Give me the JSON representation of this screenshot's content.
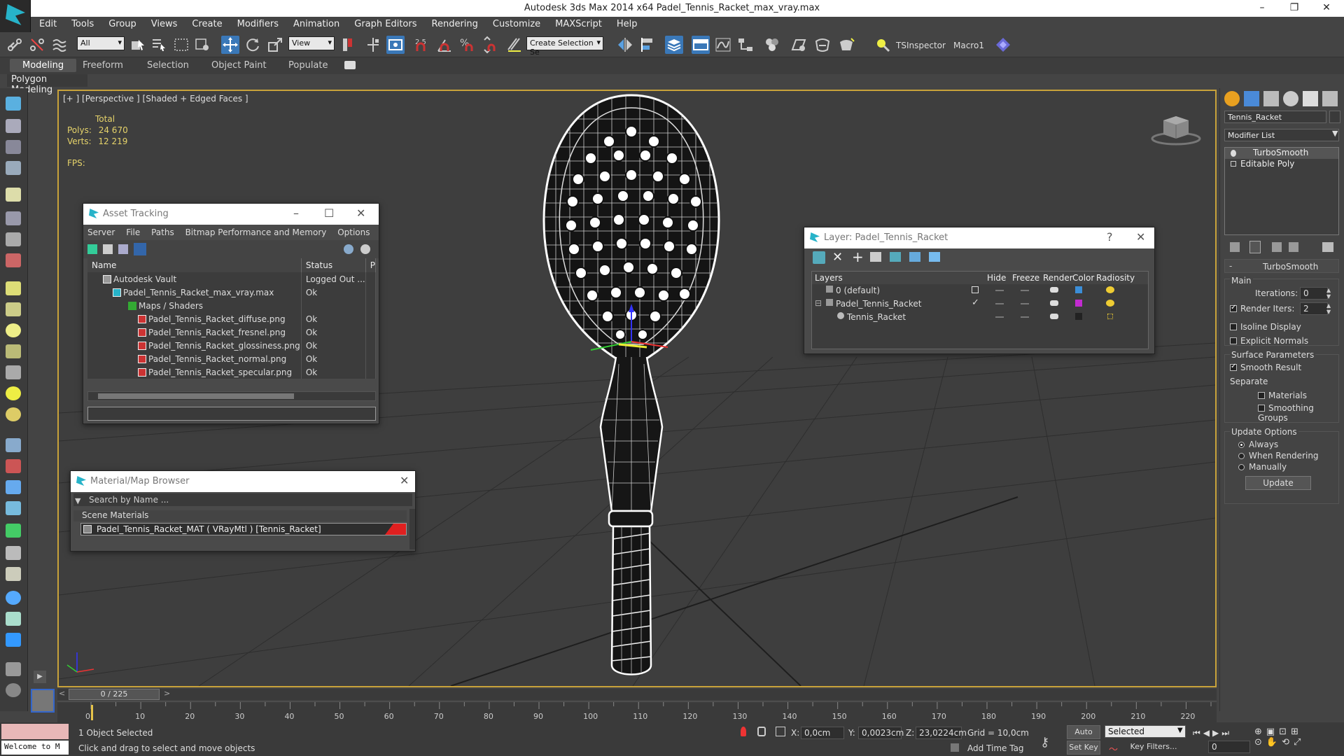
{
  "window": {
    "title": "Autodesk 3ds Max  2014 x64     Padel_Tennis_Racket_max_vray.max"
  },
  "menu": [
    "Edit",
    "Tools",
    "Group",
    "Views",
    "Create",
    "Modifiers",
    "Animation",
    "Graph Editors",
    "Rendering",
    "Customize",
    "MAXScript",
    "Help"
  ],
  "toolbar": {
    "selection_filter": "All",
    "ref_coord": "View",
    "snap_angle": "2.5",
    "named_selection": "Create Selection Se",
    "ts_inspector": "TSInspector",
    "macro": "Macro1"
  },
  "ribbon": {
    "tabs": [
      "Modeling",
      "Freeform",
      "Selection",
      "Object Paint",
      "Populate"
    ],
    "sub_label": "Polygon Modeling"
  },
  "viewport": {
    "label": "[+ ] [Perspective ] [Shaded + Edged Faces ]",
    "stats_header": "Total",
    "polys_label": "Polys:",
    "polys_value": "24 670",
    "verts_label": "Verts:",
    "verts_value": "12 219",
    "fps_label": "FPS:"
  },
  "asset_tracking": {
    "title": "Asset Tracking",
    "menu": [
      "Server",
      "File",
      "Paths",
      "Bitmap Performance and Memory",
      "Options"
    ],
    "columns": [
      "Name",
      "Status",
      "P"
    ],
    "rows": [
      {
        "name": "Autodesk Vault",
        "status": "Logged Out ..."
      },
      {
        "name": "Padel_Tennis_Racket_max_vray.max",
        "status": "Ok"
      },
      {
        "name": "Maps / Shaders",
        "status": ""
      },
      {
        "name": "Padel_Tennis_Racket_diffuse.png",
        "status": "Ok"
      },
      {
        "name": "Padel_Tennis_Racket_fresnel.png",
        "status": "Ok"
      },
      {
        "name": "Padel_Tennis_Racket_glossiness.png",
        "status": "Ok"
      },
      {
        "name": "Padel_Tennis_Racket_normal.png",
        "status": "Ok"
      },
      {
        "name": "Padel_Tennis_Racket_specular.png",
        "status": "Ok"
      }
    ]
  },
  "layer_window": {
    "title": "Layer: Padel_Tennis_Racket",
    "help": "?",
    "columns": [
      "Layers",
      "Hide",
      "Freeze",
      "Render",
      "Color",
      "Radiosity"
    ],
    "rows": [
      {
        "name": "0 (default)",
        "color": "#3b8ed8"
      },
      {
        "name": "Padel_Tennis_Racket",
        "color": "#c22bd0"
      },
      {
        "name": "Tennis_Racket",
        "color": "#222222"
      }
    ]
  },
  "material_browser": {
    "title": "Material/Map Browser",
    "search_placeholder": "Search by Name ...",
    "category": "Scene Materials",
    "material": "Padel_Tennis_Racket_MAT  ( VRayMtl )  [Tennis_Racket]"
  },
  "command_panel": {
    "object_name": "Tennis_Racket",
    "modifier_list": "Modifier List",
    "stack": [
      "TurboSmooth",
      "Editable Poly"
    ],
    "rollout_title": "TurboSmooth",
    "main_label": "Main",
    "iterations_label": "Iterations:",
    "iterations_value": "0",
    "render_iters_label": "Render Iters:",
    "render_iters_value": "2",
    "isoline_label": "Isoline Display",
    "explicit_normals_label": "Explicit Normals",
    "surface_params_label": "Surface Parameters",
    "smooth_result_label": "Smooth Result",
    "separate_label": "Separate",
    "materials_label": "Materials",
    "smoothing_groups_label": "Smoothing Groups",
    "update_options_label": "Update Options",
    "always_label": "Always",
    "when_rendering_label": "When Rendering",
    "manually_label": "Manually",
    "update_button": "Update"
  },
  "timeline": {
    "frame_counter": "0 / 225",
    "ticks": [
      "0",
      "10",
      "20",
      "30",
      "40",
      "50",
      "60",
      "70",
      "80",
      "90",
      "100",
      "110",
      "120",
      "130",
      "140",
      "150",
      "160",
      "170",
      "180",
      "190",
      "200",
      "210",
      "220"
    ]
  },
  "status": {
    "maxscript": "Welcome to M",
    "selected": "1 Object Selected",
    "prompt": "Click and drag to select and move objects",
    "x_label": "X:",
    "x_value": "0,0cm",
    "y_label": "Y:",
    "y_value": "0,0023cm",
    "z_label": "Z:",
    "z_value": "23,0224cm",
    "grid": "Grid = 10,0cm",
    "add_time_tag": "Add Time Tag",
    "auto_key": "Auto Key",
    "set_key": "Set Key",
    "key_mode": "Selected",
    "key_filters": "Key Filters...",
    "frame_value": "0"
  }
}
